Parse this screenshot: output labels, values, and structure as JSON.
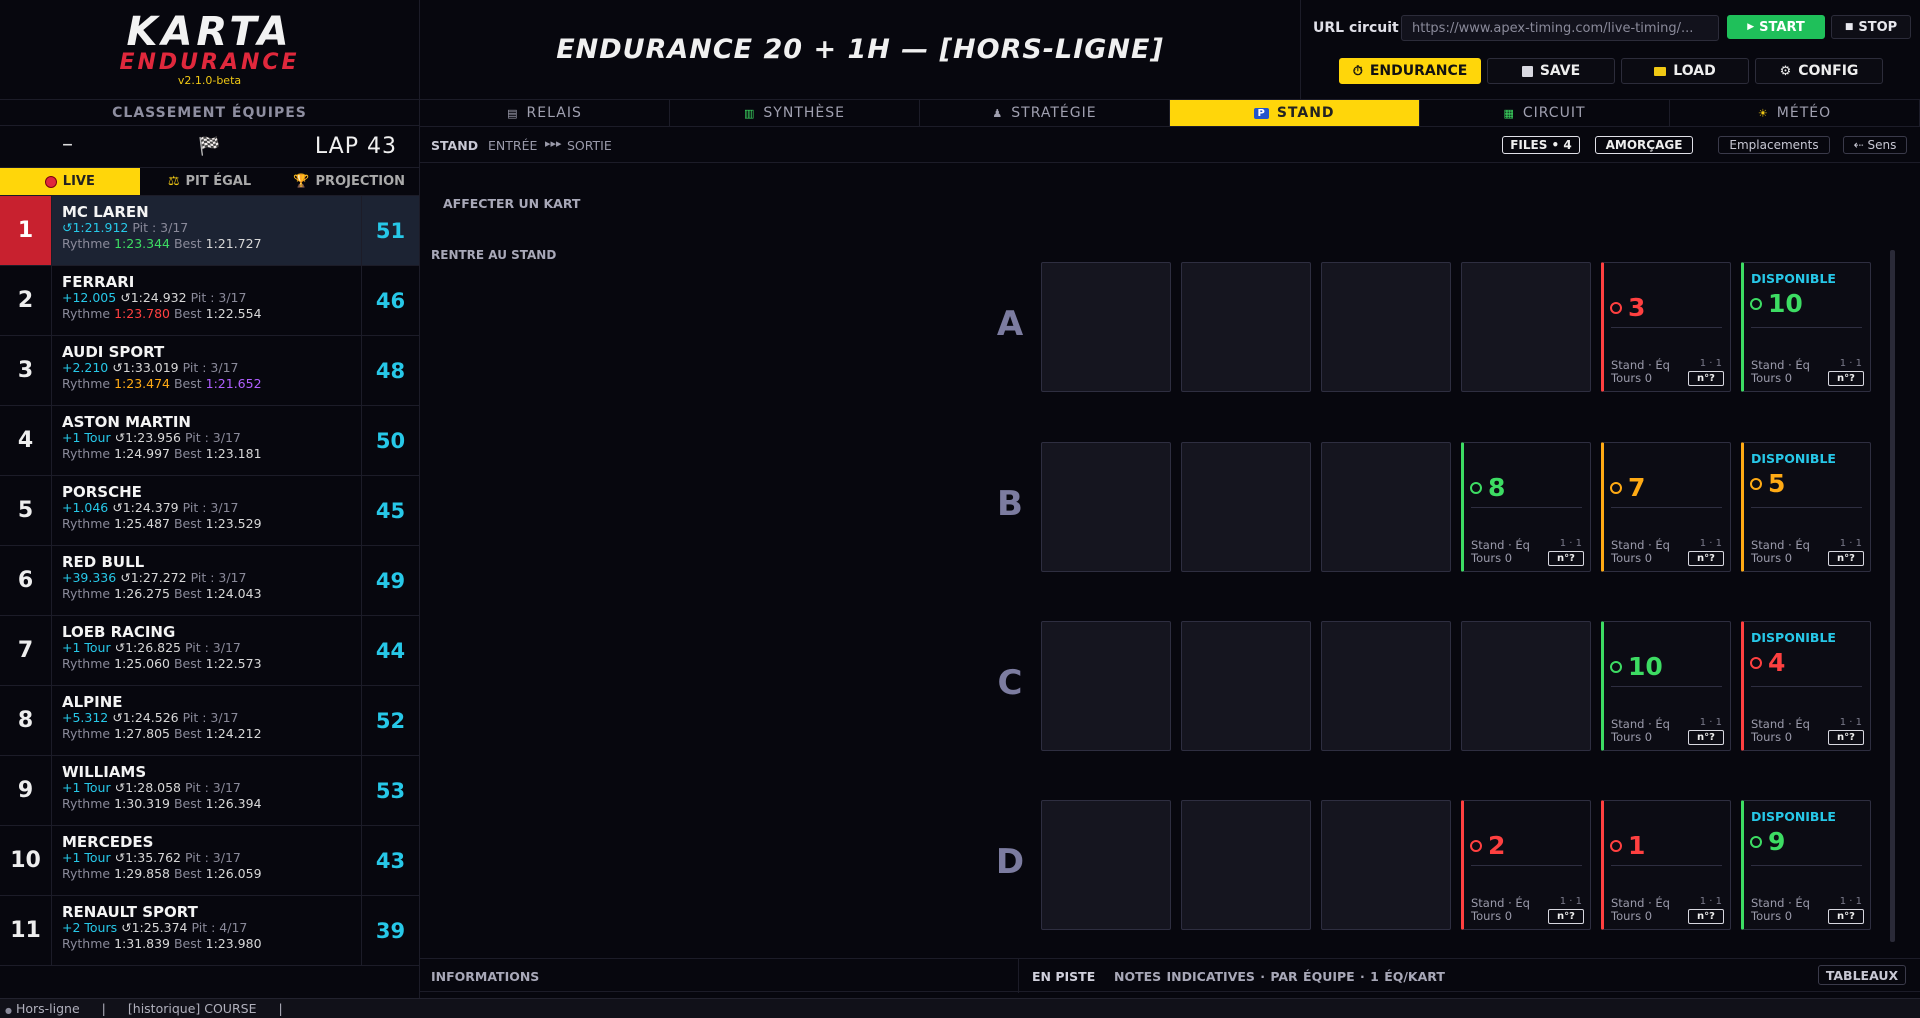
{
  "logo": {
    "line1": "KARTA",
    "line2": "ENDURANCE",
    "version": "v2.1.0-beta"
  },
  "header": {
    "title": "ENDURANCE 20 + 1H  —  [HORS-LIGNE]"
  },
  "controls": {
    "url_label": "URL circuit .",
    "url_value": "https://www.apex-timing.com/live-timing/...",
    "start": "START",
    "stop": "STOP",
    "endurance": "ENDURANCE",
    "save": "SAVE",
    "load": "LOAD",
    "config": "CONFIG"
  },
  "left": {
    "title": "CLASSEMENT ÉQUIPES",
    "dash": "–",
    "lap": "LAP 43",
    "modes": [
      "LIVE",
      "PIT ÉGAL",
      "PROJECTION"
    ],
    "labels": {
      "rythme": "Rythme",
      "best": "Best"
    },
    "teams": [
      {
        "pos": "1",
        "name": "MC LAREN",
        "gap": "",
        "last": "1:21.912",
        "pit": "Pit : 3/17",
        "rythme": "1:23.344",
        "rythme_color": "green",
        "best": "1:21.727",
        "best_color": "white",
        "kart": "51"
      },
      {
        "pos": "2",
        "name": "FERRARI",
        "gap": "+12.005",
        "last": "1:24.932",
        "pit": "Pit : 3/17",
        "rythme": "1:23.780",
        "rythme_color": "red",
        "best": "1:22.554",
        "best_color": "white",
        "kart": "46"
      },
      {
        "pos": "3",
        "name": "AUDI SPORT",
        "gap": "+2.210",
        "last": "1:33.019",
        "pit": "Pit : 3/17",
        "rythme": "1:23.474",
        "rythme_color": "orange",
        "best": "1:21.652",
        "best_color": "purple",
        "kart": "48"
      },
      {
        "pos": "4",
        "name": "ASTON MARTIN",
        "gap": "+1 Tour",
        "last": "1:23.956",
        "pit": "Pit : 3/17",
        "rythme": "1:24.997",
        "rythme_color": "white",
        "best": "1:23.181",
        "best_color": "white",
        "kart": "50"
      },
      {
        "pos": "5",
        "name": "PORSCHE",
        "gap": "+1.046",
        "last": "1:24.379",
        "pit": "Pit : 3/17",
        "rythme": "1:25.487",
        "rythme_color": "white",
        "best": "1:23.529",
        "best_color": "white",
        "kart": "45"
      },
      {
        "pos": "6",
        "name": "RED BULL",
        "gap": "+39.336",
        "last": "1:27.272",
        "pit": "Pit : 3/17",
        "rythme": "1:26.275",
        "rythme_color": "white",
        "best": "1:24.043",
        "best_color": "white",
        "kart": "49"
      },
      {
        "pos": "7",
        "name": "LOEB RACING",
        "gap": "+1 Tour",
        "last": "1:26.825",
        "pit": "Pit : 3/17",
        "rythme": "1:25.060",
        "rythme_color": "white",
        "best": "1:22.573",
        "best_color": "white",
        "kart": "44"
      },
      {
        "pos": "8",
        "name": "ALPINE",
        "gap": "+5.312",
        "last": "1:24.526",
        "pit": "Pit : 3/17",
        "rythme": "1:27.805",
        "rythme_color": "white",
        "best": "1:24.212",
        "best_color": "white",
        "kart": "52"
      },
      {
        "pos": "9",
        "name": "WILLIAMS",
        "gap": "+1 Tour",
        "last": "1:28.058",
        "pit": "Pit : 3/17",
        "rythme": "1:30.319",
        "rythme_color": "white",
        "best": "1:26.394",
        "best_color": "white",
        "kart": "53"
      },
      {
        "pos": "10",
        "name": "MERCEDES",
        "gap": "+1 Tour",
        "last": "1:35.762",
        "pit": "Pit : 3/17",
        "rythme": "1:29.858",
        "rythme_color": "white",
        "best": "1:26.059",
        "best_color": "white",
        "kart": "43"
      },
      {
        "pos": "11",
        "name": "RENAULT SPORT",
        "gap": "+2 Tours",
        "last": "1:25.374",
        "pit": "Pit : 4/17",
        "rythme": "1:31.839",
        "rythme_color": "white",
        "best": "1:23.980",
        "best_color": "white",
        "kart": "39"
      }
    ]
  },
  "tabs": [
    "RELAIS",
    "SYNTHÈSE",
    "STRATÉGIE",
    "STAND",
    "CIRCUIT",
    "MÉTÉO"
  ],
  "subbar": {
    "stand": "STAND",
    "entree": "ENTRÉE",
    "arrows": "▸▸▸",
    "sortie": "SORTIE",
    "files": "FILES • 4",
    "amorcage": "AMORÇAGE",
    "emplacements": "Emplacements",
    "sens": "⇠ Sens"
  },
  "main": {
    "affecter": "AFFECTER UN KART",
    "rentre": "RENTRE AU STAND"
  },
  "card_labels": {
    "stand_eq": "Stand · Éq",
    "tours": "Tours 0",
    "ratio": "1 · 1",
    "nbtn": "n°?",
    "disponible": "DISPONIBLE"
  },
  "stand_rows": [
    {
      "label": "A",
      "cards": [
        {
          "col": 4,
          "num": "3",
          "color": "red",
          "disp": false
        },
        {
          "col": 5,
          "num": "10",
          "color": "green",
          "disp": true
        }
      ]
    },
    {
      "label": "B",
      "cards": [
        {
          "col": 3,
          "num": "8",
          "color": "green",
          "disp": false
        },
        {
          "col": 4,
          "num": "7",
          "color": "orange",
          "disp": false
        },
        {
          "col": 5,
          "num": "5",
          "color": "orange",
          "disp": true
        }
      ]
    },
    {
      "label": "C",
      "cards": [
        {
          "col": 4,
          "num": "10",
          "color": "green",
          "disp": false
        },
        {
          "col": 5,
          "num": "4",
          "color": "red",
          "disp": true
        }
      ]
    },
    {
      "label": "D",
      "cards": [
        {
          "col": 3,
          "num": "2",
          "color": "red",
          "disp": false
        },
        {
          "col": 4,
          "num": "1",
          "color": "red",
          "disp": false
        },
        {
          "col": 5,
          "num": "9",
          "color": "green",
          "disp": true
        }
      ]
    }
  ],
  "bottom": {
    "informations": "INFORMATIONS",
    "en_piste": "EN PISTE",
    "notes": "NOTES INDICATIVES  ·  PAR ÉQUIPE  ·  1 ÉQ/KART",
    "tableaux": "TABLEAUX"
  },
  "status": {
    "state": "Hors-ligne",
    "sep": "|",
    "history": "[historique] COURSE"
  }
}
